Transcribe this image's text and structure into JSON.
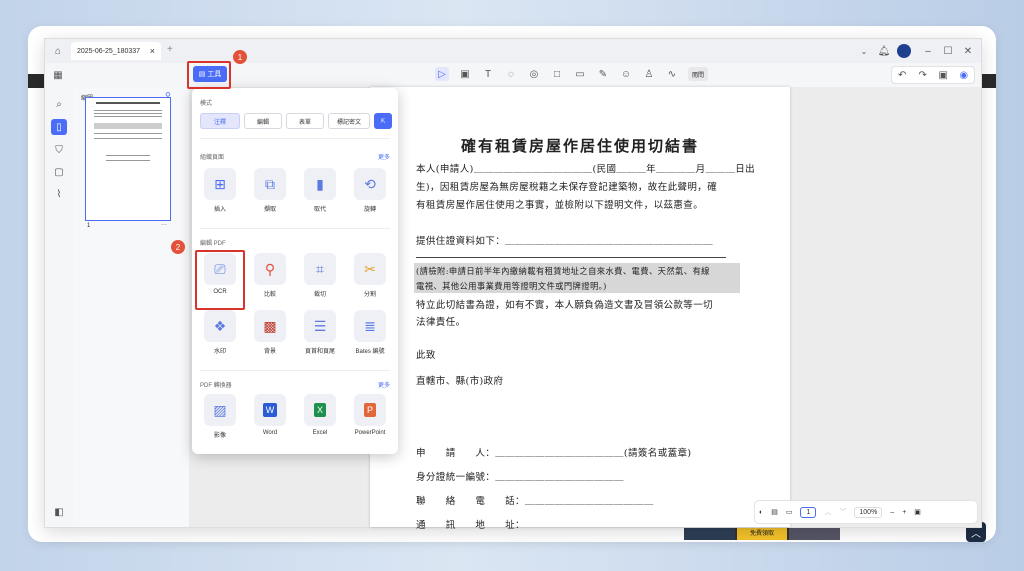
{
  "window": {
    "tab_title": "2025-06-25_180337",
    "tab_close": "×",
    "tab_add": "+"
  },
  "toolbar": {
    "tools_label": "工具",
    "view_label": "閱問"
  },
  "thumbs": {
    "title": "縮圖",
    "page_num": "1",
    "more": "···"
  },
  "popup": {
    "mode_title": "模式",
    "modes": [
      "注釋",
      "編輯",
      "表單",
      "標記密文"
    ],
    "organize_title": "組織頁面",
    "organize_more": "更多",
    "organize_tools": [
      "插入",
      "擷取",
      "取代",
      "旋轉"
    ],
    "edit_title": "編輯 PDF",
    "edit_tools": [
      "OCR",
      "比較",
      "裁切",
      "分割",
      "水印",
      "背景",
      "頁首和頁尾",
      "Bates 編號"
    ],
    "convert_title": "PDF 轉換器",
    "convert_more": "更多",
    "convert_tools": [
      "影像",
      "Word",
      "Excel",
      "PowerPoint"
    ]
  },
  "markers": {
    "m1": "1",
    "m2": "2"
  },
  "document": {
    "title": "確有租賃房屋作居住使用切結書",
    "l1": "本人(申請人)＿＿＿＿＿＿＿＿＿＿＿＿(民國＿＿＿年＿＿＿＿月＿＿＿日出",
    "l2": "生)，因租賃房屋為無房屋稅籍之未保存登記建築物，故在此聲明，確",
    "l3": "有租賃房屋作居住使用之事實，並檢附以下證明文件，以茲惠查。",
    "l4": "提供住證資料如下：＿＿＿＿＿＿＿＿＿＿＿＿＿＿＿＿＿＿＿＿＿",
    "l5": "(請檢附:申請日前半年內繳納載有租賃地址之自來水費、電費、天然氣、有線",
    "l6": "電視、其他公用事業費用等證明文件或門牌證明。)",
    "l7": "特立此切結書為證，如有不實，本人願負偽造文書及冒領公款等一切",
    "l8": "法律責任。",
    "l9": "此致",
    "l10": "直轄市、縣(市)政府",
    "l11": "申　　請　　人：＿＿＿＿＿＿＿＿＿＿＿＿＿(請簽名或蓋章)",
    "l12": "身分證統一編號：＿＿＿＿＿＿＿＿＿＿＿＿＿",
    "l13": "聯　　絡　　電　　話：＿＿＿＿＿＿＿＿＿＿＿＿＿",
    "l14": "通　　訊　　地　　址："
  },
  "status": {
    "page": "1",
    "zoom": "100%"
  },
  "bg": {
    "free_ad": "免費領取"
  },
  "colors": {
    "accent": "#4a6cf7",
    "marker": "#e2513a",
    "highlight": "#d9342b"
  }
}
